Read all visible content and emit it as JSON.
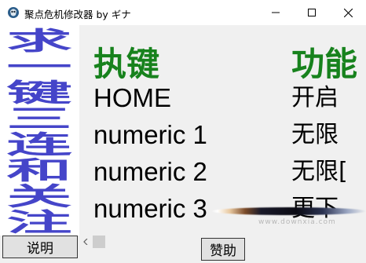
{
  "window": {
    "title": "聚点危机修改器 by ギナ",
    "icons": {
      "app": "app-icon",
      "minimize": "minimize-icon",
      "maximize": "maximize-icon",
      "close": "close-icon"
    }
  },
  "slogan": {
    "chars": [
      "求",
      "一",
      "键",
      "三",
      "连",
      "和",
      "关",
      "注"
    ],
    "color": "#4545c9"
  },
  "table": {
    "header_key": "执键",
    "header_func": "功能",
    "header_color": "#17821d",
    "rows": [
      {
        "key": "HOME",
        "func": "开启"
      },
      {
        "key": "numeric 1",
        "func": "无限"
      },
      {
        "key": "numeric 2",
        "func": "无限["
      },
      {
        "key": "numeric 3",
        "func": "更下"
      }
    ]
  },
  "watermark": "www.downxia.com",
  "buttons": {
    "help": "说明",
    "sponsor": "赞助"
  }
}
